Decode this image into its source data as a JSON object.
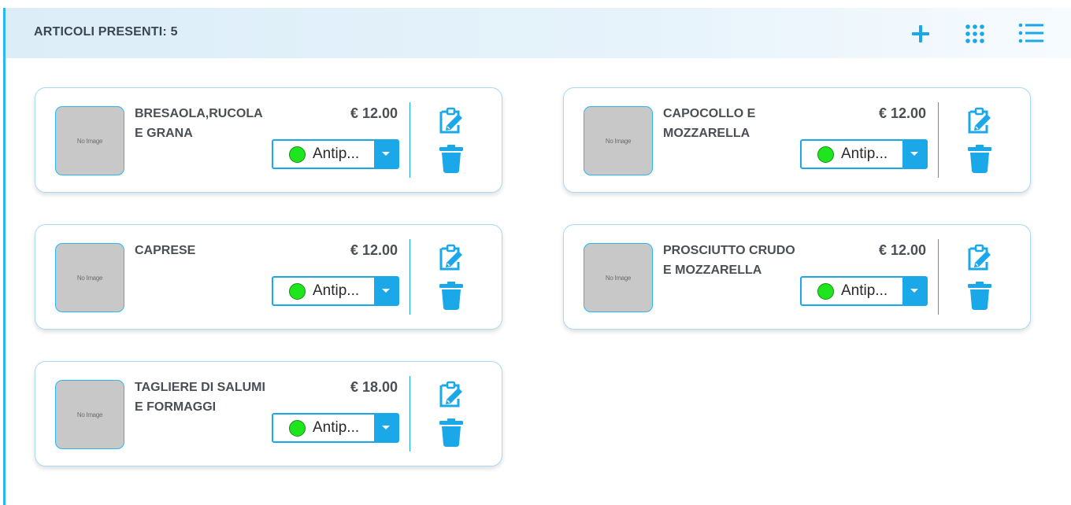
{
  "header": {
    "title": "ARTICOLI PRESENTI: 5",
    "add_icon": "plus-icon",
    "grid_icon": "grid-view-icon",
    "list_icon": "list-view-icon"
  },
  "accent_color": "#1aa8e8",
  "items": [
    {
      "name_line1": "BRESAOLA,RUCOLA",
      "name_line2": "E GRANA",
      "price": "€ 12.00",
      "category": "Antip...",
      "image_text": "No Image",
      "category_color": "#1fe51f"
    },
    {
      "name_line1": "CAPOCOLLO E",
      "name_line2": "MOZZARELLA",
      "price": "€ 12.00",
      "category": "Antip...",
      "image_text": "No Image",
      "category_color": "#1fe51f"
    },
    {
      "name_line1": "CAPRESE",
      "name_line2": "",
      "price": "€ 12.00",
      "category": "Antip...",
      "image_text": "No Image",
      "category_color": "#1fe51f"
    },
    {
      "name_line1": "PROSCIUTTO CRUDO",
      "name_line2": "E MOZZARELLA",
      "price": "€ 12.00",
      "category": "Antip...",
      "image_text": "No Image",
      "category_color": "#1fe51f"
    },
    {
      "name_line1": "TAGLIERE DI SALUMI",
      "name_line2": "E FORMAGGI",
      "price": "€ 18.00",
      "category": "Antip...",
      "image_text": "No Image",
      "category_color": "#1fe51f"
    }
  ]
}
